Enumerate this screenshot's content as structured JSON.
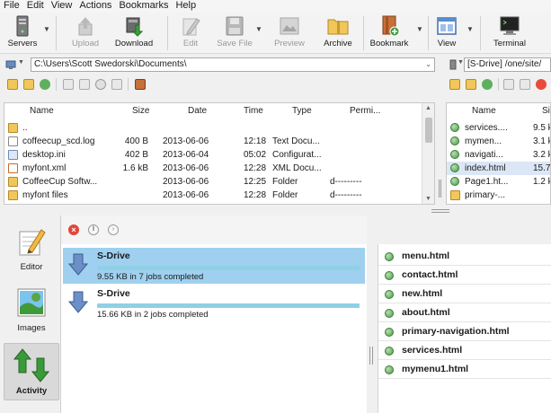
{
  "menu": [
    "File",
    "Edit",
    "View",
    "Actions",
    "Bookmarks",
    "Help"
  ],
  "toolbar": {
    "servers": "Servers",
    "upload": "Upload",
    "download": "Download",
    "edit": "Edit",
    "save_file": "Save File",
    "preview": "Preview",
    "archive": "Archive",
    "bookmark": "Bookmark",
    "view": "View",
    "terminal": "Terminal"
  },
  "local": {
    "path": "C:\\Users\\Scott Swedorski\\Documents\\",
    "columns": {
      "name": "Name",
      "size": "Size",
      "date": "Date",
      "time": "Time",
      "type": "Type",
      "perm": "Permi..."
    },
    "rows": [
      {
        "name": "..",
        "size": "",
        "date": "",
        "time": "",
        "type": "",
        "perm": ""
      },
      {
        "name": "coffeecup_scd.log",
        "size": "400 B",
        "date": "2013-06-06",
        "time": "12:18",
        "type": "Text Docu...",
        "perm": ""
      },
      {
        "name": "desktop.ini",
        "size": "402 B",
        "date": "2013-06-04",
        "time": "05:02",
        "type": "Configurat...",
        "perm": ""
      },
      {
        "name": "myfont.xml",
        "size": "1.6 kB",
        "date": "2013-06-06",
        "time": "12:28",
        "type": "XML Docu...",
        "perm": ""
      },
      {
        "name": "CoffeeCup Softw...",
        "size": "",
        "date": "2013-06-06",
        "time": "12:25",
        "type": "Folder",
        "perm": "d---------"
      },
      {
        "name": "myfont files",
        "size": "",
        "date": "2013-06-06",
        "time": "12:28",
        "type": "Folder",
        "perm": "d---------"
      }
    ]
  },
  "remote": {
    "server": "[S-Drive]",
    "path": "/one/site/",
    "columns": {
      "name": "Name",
      "size": "Si"
    },
    "rows": [
      {
        "name": "services....",
        "size": "9.5 k"
      },
      {
        "name": "mymen...",
        "size": "3.1 k"
      },
      {
        "name": "navigati...",
        "size": "3.2 k"
      },
      {
        "name": "index.html",
        "size": "15.7 k"
      },
      {
        "name": "Page1.ht...",
        "size": "1.2 k"
      },
      {
        "name": "primary-...",
        "size": ""
      }
    ]
  },
  "sidebar": {
    "editor": "Editor",
    "images": "Images",
    "activity": "Activity"
  },
  "jobs": [
    {
      "name": "S-Drive",
      "info": "9.55 KB in 7 jobs completed",
      "progress": 1.0
    },
    {
      "name": "S-Drive",
      "info": "15.66 KB in 2 jobs completed",
      "progress": 1.0
    }
  ],
  "job_files": [
    "menu.html",
    "contact.html",
    "new.html",
    "about.html",
    "primary-navigation.html",
    "services.html",
    "mymenu1.html"
  ],
  "colors": {
    "selection": "#9fd0ef",
    "progress": "#8fd0e6",
    "folder": "#f1c75b",
    "accent_green": "#3a9a3a"
  }
}
